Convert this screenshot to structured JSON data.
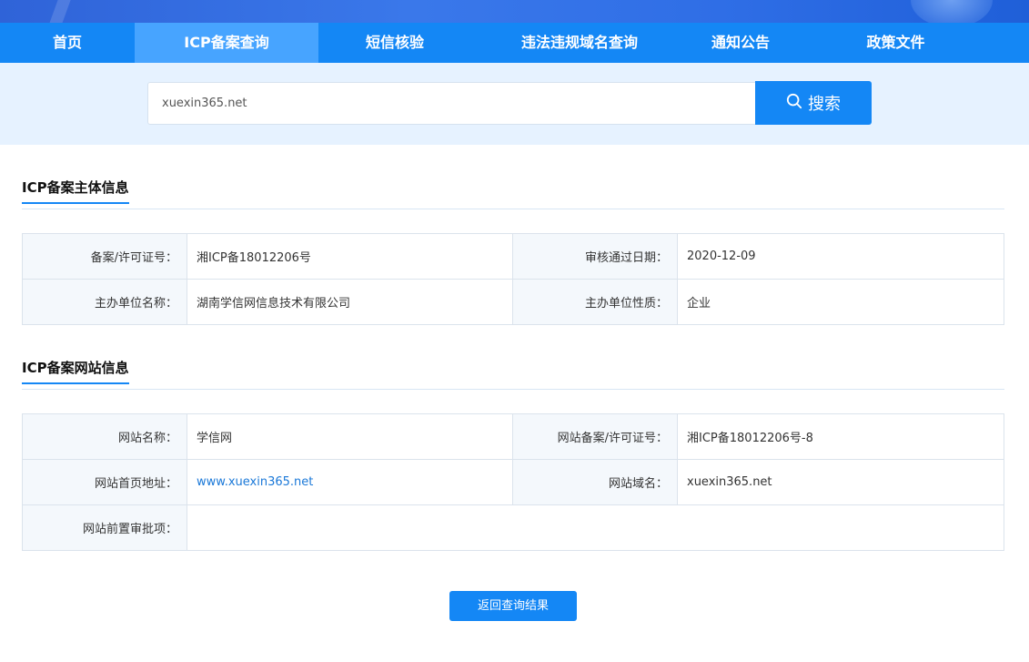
{
  "nav": {
    "items": [
      {
        "label": "首页",
        "active": false
      },
      {
        "label": "ICP备案查询",
        "active": true
      },
      {
        "label": "短信核验",
        "active": false
      },
      {
        "label": "违法违规域名查询",
        "active": false
      },
      {
        "label": "通知公告",
        "active": false
      },
      {
        "label": "政策文件",
        "active": false
      }
    ]
  },
  "search": {
    "value": "xuexin365.net",
    "button_label": "搜索",
    "button_icon": "search-icon"
  },
  "entity_section": {
    "title": "ICP备案主体信息",
    "rows": [
      {
        "label1": "备案/许可证号：",
        "value1": "湘ICP备18012206号",
        "label2": "审核通过日期：",
        "value2": "2020-12-09"
      },
      {
        "label1": "主办单位名称：",
        "value1": "湖南学信网信息技术有限公司",
        "label2": "主办单位性质：",
        "value2": "企业"
      }
    ]
  },
  "website_section": {
    "title": "ICP备案网站信息",
    "rows": [
      {
        "label1": "网站名称：",
        "value1": "学信网",
        "label2": "网站备案/许可证号：",
        "value2": "湘ICP备18012206号-8"
      },
      {
        "label1": "网站首页地址：",
        "value1": "www.xuexin365.net",
        "label2": "网站域名：",
        "value2": "xuexin365.net"
      },
      {
        "label1": "网站前置审批项：",
        "value1": ""
      }
    ]
  },
  "back_button": {
    "label": "返回查询结果"
  },
  "colors": {
    "primary": "#1487f5",
    "active_tab": "#47a4ff",
    "band": "#e6f2ff",
    "link": "#1a78d8"
  }
}
